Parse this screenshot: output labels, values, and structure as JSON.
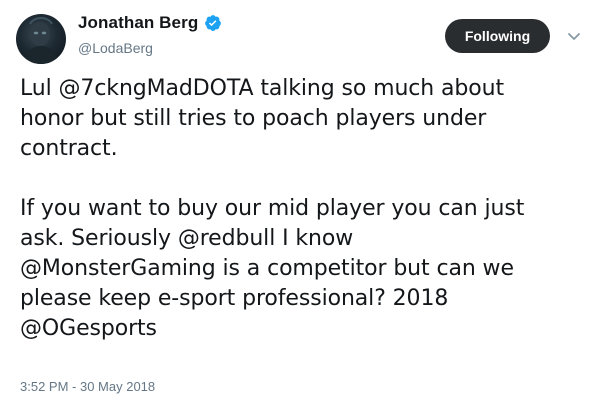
{
  "author": {
    "display_name": "Jonathan Berg",
    "handle": "@LodaBerg",
    "verified": true
  },
  "actions": {
    "follow_label": "Following"
  },
  "tweet": {
    "paragraph_1": "Lul @7ckngMadDOTA talking so much about\nhonor but still tries to poach players under\ncontract.",
    "paragraph_2": "If you want to buy our mid player you can just\nask. Seriously @redbull I know\n@MonsterGaming is a competitor but can we\nplease keep e-sport professional? 2018\n@OGesports",
    "timestamp": "3:52 PM - 30 May 2018"
  },
  "colors": {
    "text": "#14171a",
    "secondary": "#657786",
    "verified_blue": "#1da1f2",
    "button_bg": "#2a2d30"
  },
  "icons": {
    "verified": "verified-badge-icon",
    "caret": "chevron-down-icon"
  }
}
